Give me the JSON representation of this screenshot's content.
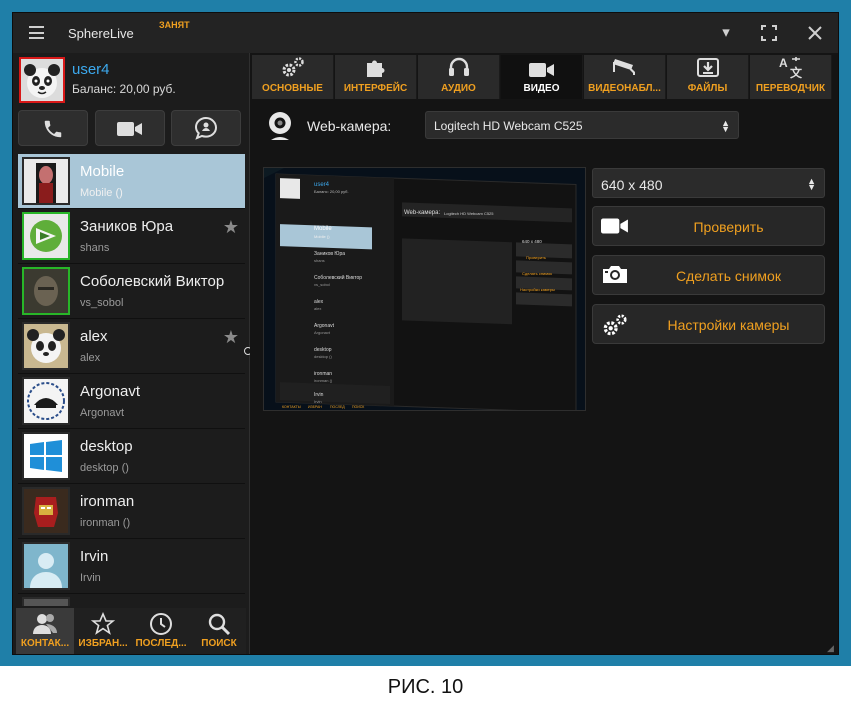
{
  "window": {
    "app_title": "SphereLive",
    "status": "ЗАНЯТ"
  },
  "user": {
    "name": "user4",
    "balance": "Баланс: 20,00 руб."
  },
  "contacts": [
    {
      "name": "Mobile",
      "sub": "Mobile ()",
      "online": false,
      "favorite": false,
      "selected": true
    },
    {
      "name": "Заников Юра",
      "sub": "shans",
      "online": true,
      "favorite": true,
      "selected": false
    },
    {
      "name": "Соболевский Виктор",
      "sub": "vs_sobol",
      "online": true,
      "favorite": false,
      "selected": false
    },
    {
      "name": "alex",
      "sub": "alex",
      "online": false,
      "favorite": true,
      "selected": false
    },
    {
      "name": "Argonavt",
      "sub": "Argonavt",
      "online": false,
      "favorite": false,
      "selected": false
    },
    {
      "name": "desktop",
      "sub": "desktop ()",
      "online": false,
      "favorite": false,
      "selected": false
    },
    {
      "name": "ironman",
      "sub": "ironman ()",
      "online": false,
      "favorite": false,
      "selected": false
    },
    {
      "name": "Irvin",
      "sub": "Irvin",
      "online": false,
      "favorite": false,
      "selected": false
    }
  ],
  "bottom_nav": [
    {
      "label": "КОНТАК...",
      "icon": "contacts-icon"
    },
    {
      "label": "ИЗБРАН...",
      "icon": "star-icon"
    },
    {
      "label": "ПОСЛЕД...",
      "icon": "clock-icon"
    },
    {
      "label": "ПОИСК",
      "icon": "search-icon"
    }
  ],
  "tabs": [
    {
      "label": "ОСНОВНЫЕ",
      "icon": "gears-icon"
    },
    {
      "label": "ИНТЕРФЕЙС",
      "icon": "puzzle-icon"
    },
    {
      "label": "АУДИО",
      "icon": "headset-icon"
    },
    {
      "label": "ВИДЕО",
      "icon": "video-camera-icon",
      "active": true
    },
    {
      "label": "ВИДЕОНАБЛ...",
      "icon": "cctv-icon"
    },
    {
      "label": "ФАЙЛЫ",
      "icon": "download-icon"
    },
    {
      "label": "ПЕРЕВОДЧИК",
      "icon": "translate-icon"
    }
  ],
  "video": {
    "webcam_label": "Web-камера:",
    "webcam_device": "Logitech HD Webcam C525",
    "resolution": "640 x 480",
    "check_label": "Проверить",
    "snapshot_label": "Сделать снимок",
    "settings_label": "Настройки камеры"
  },
  "preview": {
    "user": "user4",
    "balance": "Баланс: 20,00 руб.",
    "webcam_label": "Web-камера:",
    "webcam_device": "Logitech HD Webcam C525",
    "resolution": "640 x 480",
    "check": "Проверить",
    "snap": "Сделать снимок",
    "settings": "Настройки камеры",
    "contacts": [
      {
        "name": "Mobile",
        "sub": "Mobile ()"
      },
      {
        "name": "Заников Юра",
        "sub": "shans"
      },
      {
        "name": "Соболевский Виктор",
        "sub": "vs_sobol"
      },
      {
        "name": "alex",
        "sub": "alex"
      },
      {
        "name": "Argonavt",
        "sub": "Argonavt"
      },
      {
        "name": "desktop",
        "sub": "desktop ()"
      },
      {
        "name": "ironman",
        "sub": "ironman ()"
      },
      {
        "name": "Irvin",
        "sub": "Irvin"
      }
    ],
    "bottom_labels": [
      "КОНТАКТЫ",
      "ИЗБРАН",
      "ПОСЛЕД",
      "ПОИСК"
    ]
  },
  "caption": "РИС. 10",
  "colors": {
    "frame": "#1f7fa8",
    "accent": "#f0a020",
    "username": "#3ca9ee",
    "online": "#28b628",
    "selected": "#a9c6d7"
  }
}
